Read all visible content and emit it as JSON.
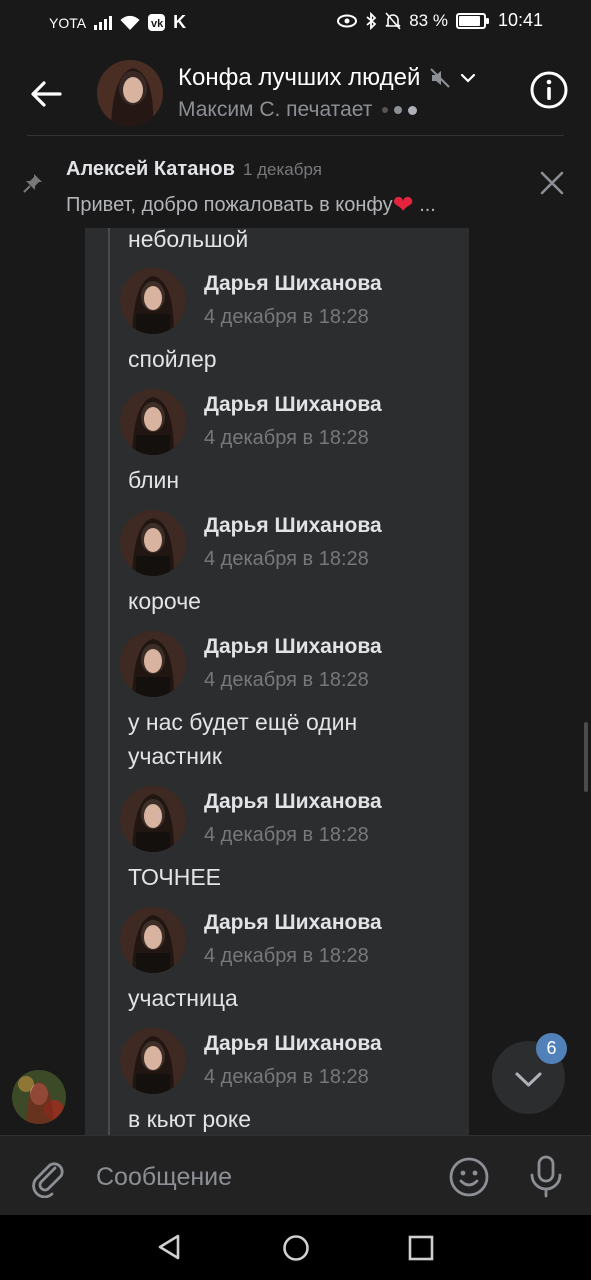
{
  "status_bar": {
    "carrier": "YOTA",
    "battery": "83 %",
    "time": "10:41"
  },
  "header": {
    "title": "Конфа лучших людей",
    "subtitle": "Максим С. печатает"
  },
  "pinned": {
    "author": "Алексей Катанов",
    "date": "1 декабря",
    "text": "Привет, добро пожаловать в конфу",
    "ellipsis": "..."
  },
  "forwarded": {
    "top_text": "небольшой",
    "messages": [
      {
        "name": "Дарья Шиханова",
        "date": "4 декабря в 18:28",
        "lines": [
          "спойлер"
        ]
      },
      {
        "name": "Дарья Шиханова",
        "date": "4 декабря в 18:28",
        "lines": [
          "блин"
        ]
      },
      {
        "name": "Дарья Шиханова",
        "date": "4 декабря в 18:28",
        "lines": [
          "короче"
        ]
      },
      {
        "name": "Дарья Шиханова",
        "date": "4 декабря в 18:28",
        "lines": [
          "у нас будет ещё один",
          "участник"
        ]
      },
      {
        "name": "Дарья Шиханова",
        "date": "4 декабря в 18:28",
        "lines": [
          "ТОЧНЕЕ"
        ]
      },
      {
        "name": "Дарья Шиханова",
        "date": "4 декабря в 18:28",
        "lines": [
          "участница"
        ]
      },
      {
        "name": "Дарья Шиханова",
        "date": "4 декабря в 18:28",
        "lines": [
          "в кьют роке"
        ]
      }
    ]
  },
  "scroll_badge": "6",
  "composer": {
    "placeholder": "Сообщение"
  },
  "colors": {
    "background": "#19191a",
    "bubble": "#2c2d2e",
    "accent": "#5181b8",
    "heart": "#e4243c"
  }
}
